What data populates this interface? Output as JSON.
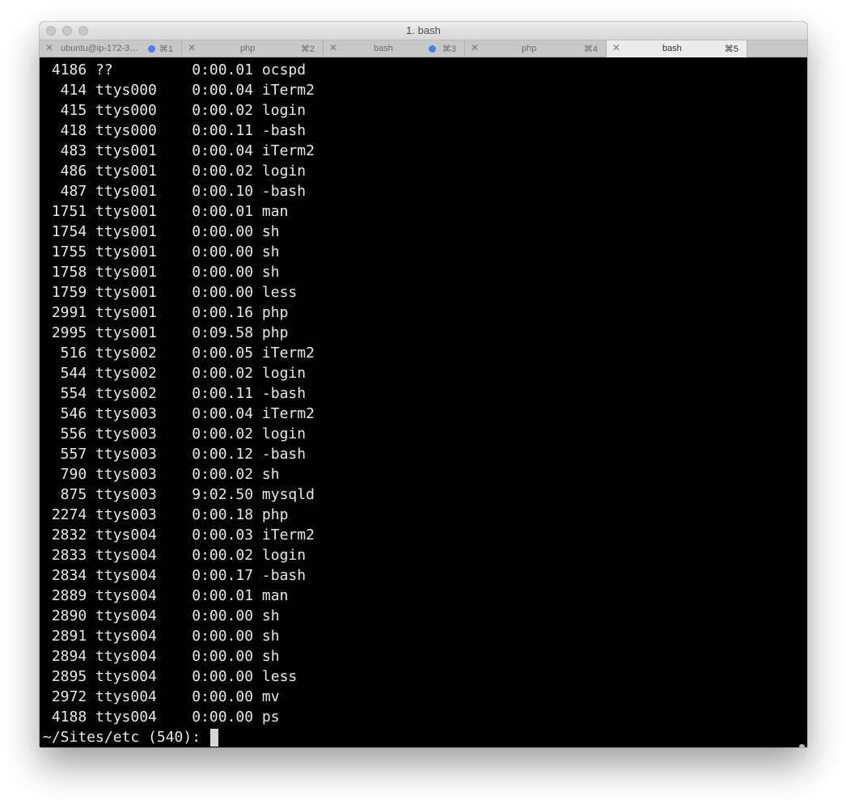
{
  "window": {
    "title": "1. bash"
  },
  "tabs": [
    {
      "label": "ubuntu@ip-172-3…",
      "shortcut": "⌘1",
      "activity": true,
      "active": false
    },
    {
      "label": "php",
      "shortcut": "⌘2",
      "activity": false,
      "active": false
    },
    {
      "label": "bash",
      "shortcut": "⌘3",
      "activity": true,
      "active": false
    },
    {
      "label": "php",
      "shortcut": "⌘4",
      "activity": false,
      "active": false
    },
    {
      "label": "bash",
      "shortcut": "⌘5",
      "activity": false,
      "active": true
    }
  ],
  "terminal": {
    "lines": [
      " 4186 ??         0:00.01 ocspd",
      "  414 ttys000    0:00.04 iTerm2",
      "  415 ttys000    0:00.02 login",
      "  418 ttys000    0:00.11 -bash",
      "  483 ttys001    0:00.04 iTerm2",
      "  486 ttys001    0:00.02 login",
      "  487 ttys001    0:00.10 -bash",
      " 1751 ttys001    0:00.01 man",
      " 1754 ttys001    0:00.00 sh",
      " 1755 ttys001    0:00.00 sh",
      " 1758 ttys001    0:00.00 sh",
      " 1759 ttys001    0:00.00 less",
      " 2991 ttys001    0:00.16 php",
      " 2995 ttys001    0:09.58 php",
      "  516 ttys002    0:00.05 iTerm2",
      "  544 ttys002    0:00.02 login",
      "  554 ttys002    0:00.11 -bash",
      "  546 ttys003    0:00.04 iTerm2",
      "  556 ttys003    0:00.02 login",
      "  557 ttys003    0:00.12 -bash",
      "  790 ttys003    0:00.02 sh",
      "  875 ttys003    9:02.50 mysqld",
      " 2274 ttys003    0:00.18 php",
      " 2832 ttys004    0:00.03 iTerm2",
      " 2833 ttys004    0:00.02 login",
      " 2834 ttys004    0:00.17 -bash",
      " 2889 ttys004    0:00.01 man",
      " 2890 ttys004    0:00.00 sh",
      " 2891 ttys004    0:00.00 sh",
      " 2894 ttys004    0:00.00 sh",
      " 2895 ttys004    0:00.00 less",
      " 2972 ttys004    0:00.00 mv",
      " 4188 ttys004    0:00.00 ps"
    ],
    "prompt": "~/Sites/etc (540):"
  }
}
